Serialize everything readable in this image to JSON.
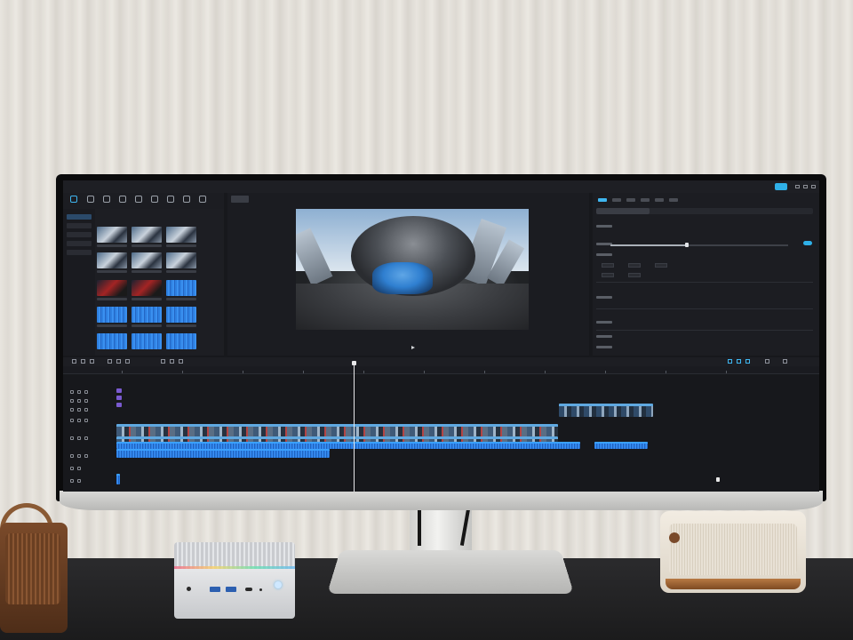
{
  "app": {
    "name": "",
    "project_title": "",
    "timecode": ""
  },
  "colors": {
    "accent": "#2fb0e8",
    "video_clip_border": "#5fa8e0",
    "audio_clip": "#2a7ee6",
    "sticker_clip": "#7a5ad0",
    "playhead": "#e8e8ea"
  },
  "brand": {
    "monitor_logo": ""
  },
  "icons": {
    "toolbar": [
      "media-icon",
      "audio-icon",
      "text-icon",
      "sticker-icon",
      "effects-icon",
      "transition-icon",
      "filter-icon",
      "adjust-icon",
      "template-icon"
    ],
    "preview_play": "play-icon",
    "timeline_tools": [
      "select-icon",
      "undo-icon",
      "redo-icon",
      "split-icon",
      "delete-icon",
      "crop-icon",
      "mirror-icon",
      "rotate-icon"
    ]
  }
}
